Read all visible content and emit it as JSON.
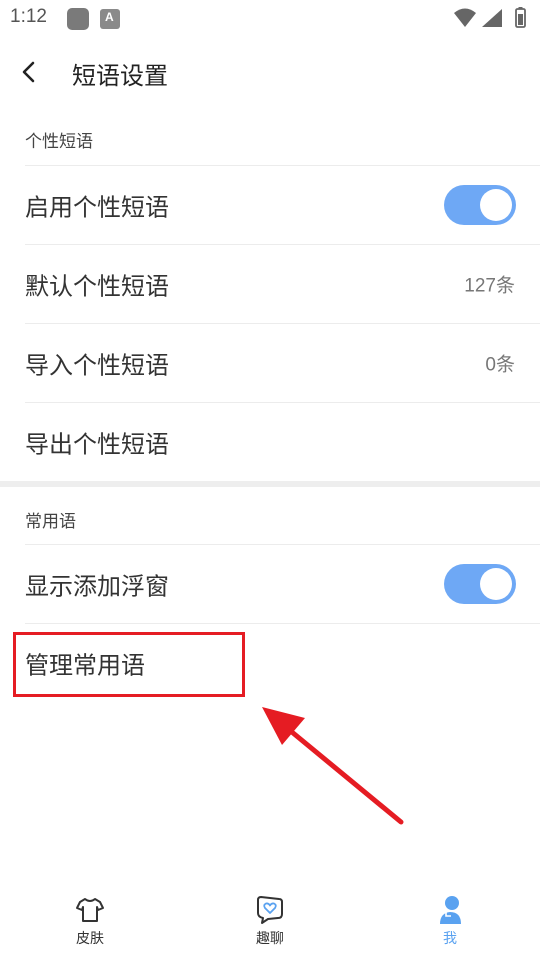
{
  "status_bar": {
    "time": "1:12"
  },
  "header": {
    "title": "短语设置"
  },
  "personal_section": {
    "title": "个性短语",
    "rows": [
      {
        "label": "启用个性短语"
      },
      {
        "label": "默认个性短语",
        "value": "127条"
      },
      {
        "label": "导入个性短语",
        "value": "0条"
      },
      {
        "label": "导出个性短语"
      }
    ],
    "toggle_enabled": true
  },
  "common_section": {
    "title": "常用语",
    "rows": [
      {
        "label": "显示添加浮窗"
      },
      {
        "label": "管理常用语"
      }
    ],
    "toggle_enabled": true
  },
  "colors": {
    "accent": "#6ea8f5",
    "tab_active": "#5aa2f0",
    "annotation": "#e51c23"
  },
  "tabbar": {
    "tabs": [
      {
        "label": "皮肤",
        "icon": "shirt-icon"
      },
      {
        "label": "趣聊",
        "icon": "chat-heart-icon"
      },
      {
        "label": "我",
        "icon": "person-icon",
        "active": true
      }
    ]
  }
}
